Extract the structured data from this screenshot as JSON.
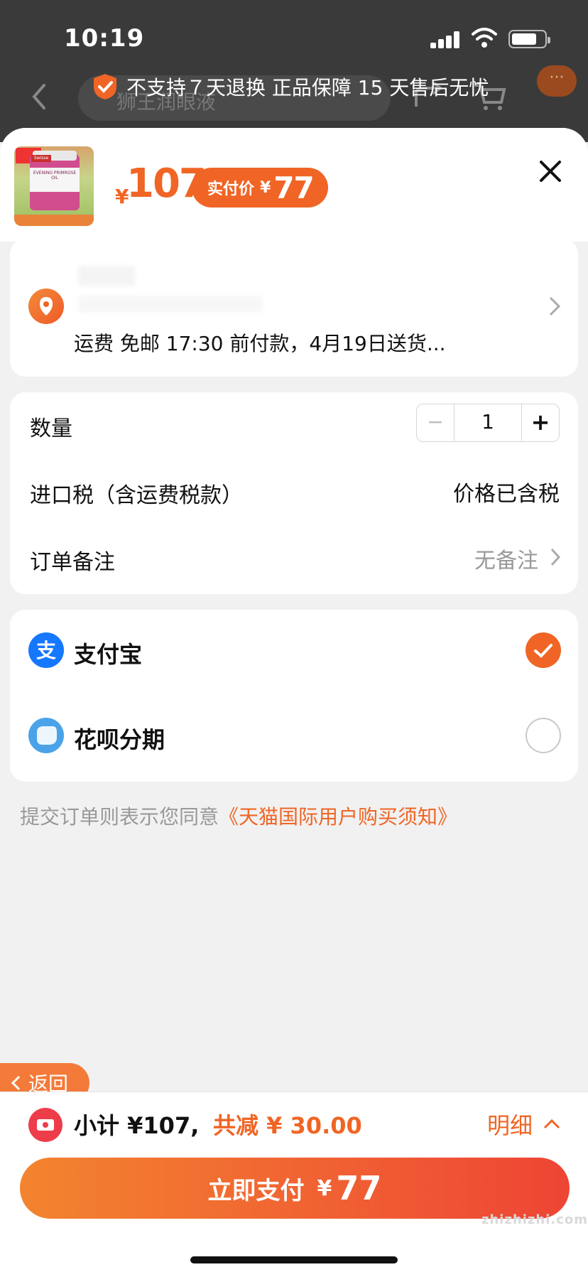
{
  "status_bar": {
    "time": "10:19"
  },
  "background_page": {
    "search_placeholder": "狮王润眼液",
    "more_label": "···"
  },
  "guarantee": {
    "text": "不支持７天退换 正品保障 15 天售后无忧"
  },
  "product": {
    "price_symbol": "¥",
    "price": "107",
    "paid_label": "实付价",
    "paid_symbol": "¥",
    "paid_value": "77",
    "image_brand": "Swisse",
    "image_caption": "EVENING PRIMROSE OIL"
  },
  "address": {
    "shipping": "运费 免邮  17:30 前付款，4月19日送货..."
  },
  "options": {
    "quantity_label": "数量",
    "quantity_value": "1",
    "minus": "−",
    "plus": "+",
    "tax_label": "进口税（含运费税款）",
    "tax_value": "价格已含税",
    "note_label": "订单备注",
    "note_value": "无备注"
  },
  "payment": {
    "methods": [
      {
        "label": "支付宝",
        "selected": true,
        "color": "#1677ff"
      },
      {
        "label": "花呗分期",
        "selected": false,
        "color": "#4aa3e8"
      }
    ]
  },
  "agreement": {
    "prefix": "提交订单则表示您同意",
    "link": "《天猫国际用户购买须知》"
  },
  "back": {
    "label": "返回"
  },
  "footer": {
    "subtotal": "小计 ¥107,",
    "reduced": "共减 ¥ 30.00",
    "detail": "明细",
    "pay_label": "立即支付",
    "pay_symbol": "¥",
    "pay_value": "77"
  },
  "watermark": "zhizhizhi.com",
  "colors": {
    "accent": "#f06525",
    "pay_gradient_start": "#f3842f",
    "pay_gradient_end": "#ee4535"
  }
}
